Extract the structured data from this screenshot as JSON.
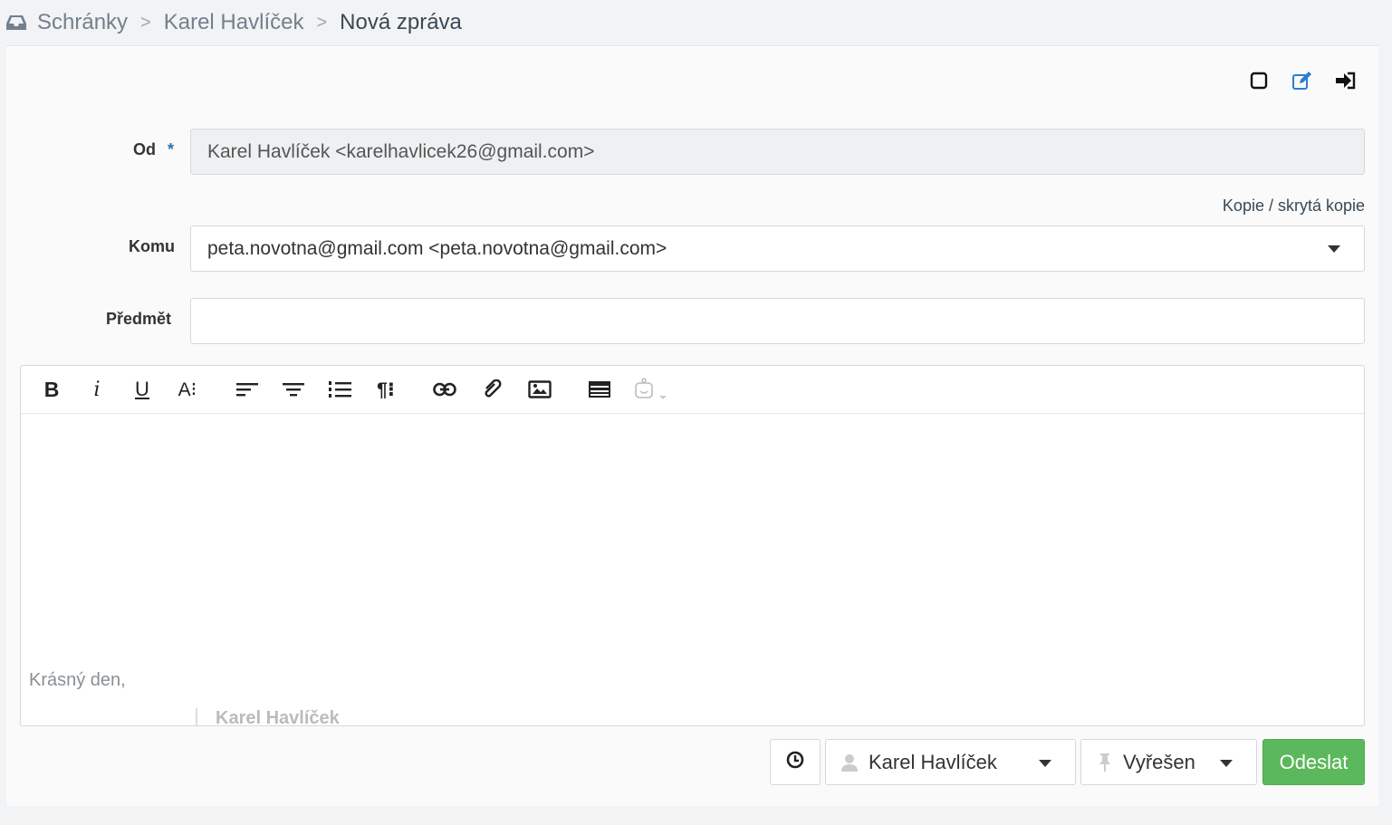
{
  "breadcrumb": {
    "items": [
      "Schránky",
      "Karel Havlíček",
      "Nová zpráva"
    ],
    "separator": ">"
  },
  "top_tools": [
    "square-icon",
    "edit-icon",
    "sign-in-icon"
  ],
  "form": {
    "from": {
      "label": "Od",
      "required_mark": "*",
      "value": "Karel Havlíček <karelhavlicek26@gmail.com>"
    },
    "cc_link": "Kopie / skrytá kopie",
    "to": {
      "label": "Komu",
      "value": "peta.novotna@gmail.com <peta.novotna@gmail.com>"
    },
    "subject": {
      "label": "Předmět",
      "value": ""
    }
  },
  "editor": {
    "toolbar": [
      "bold",
      "italic",
      "underline",
      "font-size",
      "align-left",
      "align-center",
      "ordered-list",
      "paragraph",
      "link",
      "attachment",
      "image",
      "table",
      "emoji"
    ],
    "bold_glyph": "B",
    "italic_glyph": "i",
    "underline_glyph": "U",
    "fontsize_glyph": "A⁝",
    "paragraph_glyph": "¶⁝",
    "signature_greeting": "Krásný den,",
    "signature_name": "Karel Havlíček"
  },
  "footer": {
    "assignee": "Karel Havlíček",
    "status": "Vyřešen",
    "send_label": "Odeslat"
  },
  "colors": {
    "send_button": "#5cb85c",
    "edit_icon": "#2a7ed0"
  }
}
